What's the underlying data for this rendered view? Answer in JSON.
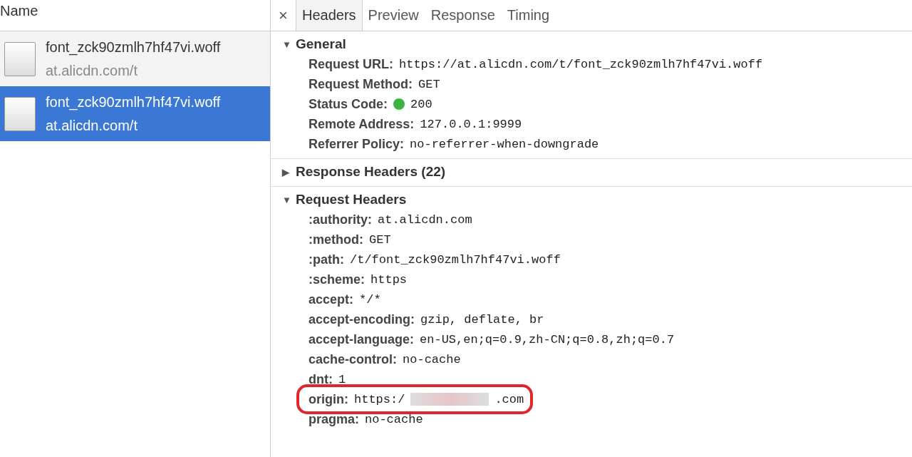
{
  "requests_panel": {
    "column_header": "Name",
    "rows": [
      {
        "filename": "font_zck90zmlh7hf47vi.woff",
        "domain": "at.alicdn.com/t",
        "selected": false
      },
      {
        "filename": "font_zck90zmlh7hf47vi.woff",
        "domain": "at.alicdn.com/t",
        "selected": true
      }
    ]
  },
  "details_panel": {
    "close": "×",
    "tabs": [
      {
        "label": "Headers",
        "selected": true
      },
      {
        "label": "Preview",
        "selected": false
      },
      {
        "label": "Response",
        "selected": false
      },
      {
        "label": "Timing",
        "selected": false
      }
    ],
    "sections": [
      {
        "toggle": "▼",
        "title": "General",
        "rows": [
          {
            "key": "Request URL:",
            "value": "https://at.alicdn.com/t/font_zck90zmlh7hf47vi.woff"
          },
          {
            "key": "Request Method:",
            "value": "GET"
          },
          {
            "key": "Status Code:",
            "value": "200",
            "color": "#3fb33f"
          },
          {
            "key": "Remote Address:",
            "value": "127.0.0.1:9999"
          },
          {
            "key": "Referrer Policy:",
            "value": "no-referrer-when-downgrade"
          }
        ]
      },
      {
        "toggle": "▶",
        "title": "Response Headers (22)"
      },
      {
        "toggle": "▼",
        "title": "Request Headers",
        "rows": [
          {
            "key": ":authority:",
            "value": "at.alicdn.com"
          },
          {
            "key": ":method:",
            "value": "GET"
          },
          {
            "key": ":path:",
            "value": "/t/font_zck90zmlh7hf47vi.woff"
          },
          {
            "key": ":scheme:",
            "value": "https"
          },
          {
            "key": "accept:",
            "value": "*/*"
          },
          {
            "key": "accept-encoding:",
            "value": "gzip, deflate, br"
          },
          {
            "key": "accept-language:",
            "value": "en-US,en;q=0.9,zh-CN;q=0.8,zh;q=0.7"
          },
          {
            "key": "cache-control:",
            "value": "no-cache"
          },
          {
            "key": "dnt:",
            "value": "1"
          },
          {
            "key": "origin:",
            "value": "https:/",
            "value_suffix": ".com",
            "redacted": true,
            "highlighted": true
          },
          {
            "key": "pragma:",
            "value": "no-cache"
          }
        ]
      }
    ]
  }
}
